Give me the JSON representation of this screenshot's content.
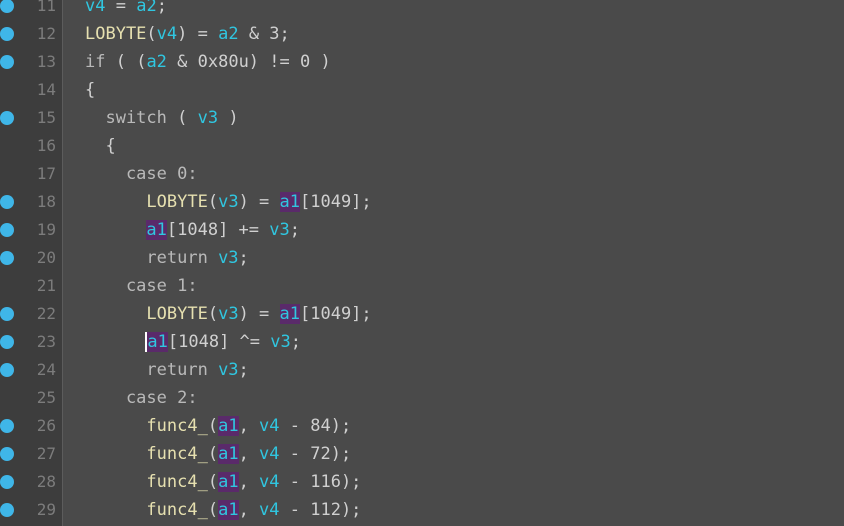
{
  "gutter": {
    "lines": [
      {
        "num": "11",
        "bp": true
      },
      {
        "num": "12",
        "bp": true
      },
      {
        "num": "13",
        "bp": true
      },
      {
        "num": "14",
        "bp": false
      },
      {
        "num": "15",
        "bp": true
      },
      {
        "num": "16",
        "bp": false
      },
      {
        "num": "17",
        "bp": false
      },
      {
        "num": "18",
        "bp": true
      },
      {
        "num": "19",
        "bp": true
      },
      {
        "num": "20",
        "bp": true
      },
      {
        "num": "21",
        "bp": false
      },
      {
        "num": "22",
        "bp": true
      },
      {
        "num": "23",
        "bp": true
      },
      {
        "num": "24",
        "bp": true
      },
      {
        "num": "25",
        "bp": false
      },
      {
        "num": "26",
        "bp": true
      },
      {
        "num": "27",
        "bp": true
      },
      {
        "num": "28",
        "bp": true
      },
      {
        "num": "29",
        "bp": true
      }
    ]
  },
  "code": {
    "lines": [
      [
        {
          "t": "v4",
          "c": "var"
        },
        {
          "t": " = ",
          "c": "op"
        },
        {
          "t": "a2",
          "c": "var"
        },
        {
          "t": ";",
          "c": "op"
        }
      ],
      [
        {
          "t": "LOBYTE",
          "c": "fn"
        },
        {
          "t": "(",
          "c": "op"
        },
        {
          "t": "v4",
          "c": "var"
        },
        {
          "t": ") = ",
          "c": "op"
        },
        {
          "t": "a2",
          "c": "var"
        },
        {
          "t": " & 3;",
          "c": "op"
        }
      ],
      [
        {
          "t": "if",
          "c": "kw"
        },
        {
          "t": " ( (",
          "c": "op"
        },
        {
          "t": "a2",
          "c": "var"
        },
        {
          "t": " & 0x80u) != 0 )",
          "c": "op"
        }
      ],
      [
        {
          "t": "{",
          "c": "op"
        }
      ],
      [
        {
          "t": "  switch",
          "c": "kw"
        },
        {
          "t": " ( ",
          "c": "op"
        },
        {
          "t": "v3",
          "c": "var"
        },
        {
          "t": " )",
          "c": "op"
        }
      ],
      [
        {
          "t": "  {",
          "c": "op"
        }
      ],
      [
        {
          "t": "    case 0:",
          "c": "kw"
        }
      ],
      [
        {
          "t": "      LOBYTE",
          "c": "fn"
        },
        {
          "t": "(",
          "c": "op"
        },
        {
          "t": "v3",
          "c": "var"
        },
        {
          "t": ") = ",
          "c": "op"
        },
        {
          "t": "a1",
          "c": "var",
          "hl": true
        },
        {
          "t": "[1049];",
          "c": "op"
        }
      ],
      [
        {
          "t": "      ",
          "c": "op"
        },
        {
          "t": "a1",
          "c": "var",
          "hl": true
        },
        {
          "t": "[1048] += ",
          "c": "op"
        },
        {
          "t": "v3",
          "c": "var"
        },
        {
          "t": ";",
          "c": "op"
        }
      ],
      [
        {
          "t": "      return ",
          "c": "kw"
        },
        {
          "t": "v3",
          "c": "var"
        },
        {
          "t": ";",
          "c": "op"
        }
      ],
      [
        {
          "t": "    case 1:",
          "c": "kw"
        }
      ],
      [
        {
          "t": "      LOBYTE",
          "c": "fn"
        },
        {
          "t": "(",
          "c": "op"
        },
        {
          "t": "v3",
          "c": "var"
        },
        {
          "t": ") = ",
          "c": "op"
        },
        {
          "t": "a1",
          "c": "var",
          "hl": true
        },
        {
          "t": "[1049];",
          "c": "op"
        }
      ],
      [
        {
          "t": "      ",
          "c": "op"
        },
        {
          "t": "a1",
          "c": "var",
          "hl": true,
          "cursor": true
        },
        {
          "t": "[1048] ^= ",
          "c": "op"
        },
        {
          "t": "v3",
          "c": "var"
        },
        {
          "t": ";",
          "c": "op"
        }
      ],
      [
        {
          "t": "      return ",
          "c": "kw"
        },
        {
          "t": "v3",
          "c": "var"
        },
        {
          "t": ";",
          "c": "op"
        }
      ],
      [
        {
          "t": "    case 2:",
          "c": "kw"
        }
      ],
      [
        {
          "t": "      func4_",
          "c": "fn"
        },
        {
          "t": "(",
          "c": "op"
        },
        {
          "t": "a1",
          "c": "var",
          "hl": true
        },
        {
          "t": ", ",
          "c": "op"
        },
        {
          "t": "v4",
          "c": "var"
        },
        {
          "t": " - 84);",
          "c": "op"
        }
      ],
      [
        {
          "t": "      func4_",
          "c": "fn"
        },
        {
          "t": "(",
          "c": "op"
        },
        {
          "t": "a1",
          "c": "var",
          "hl": true
        },
        {
          "t": ", ",
          "c": "op"
        },
        {
          "t": "v4",
          "c": "var"
        },
        {
          "t": " - 72);",
          "c": "op"
        }
      ],
      [
        {
          "t": "      func4_",
          "c": "fn"
        },
        {
          "t": "(",
          "c": "op"
        },
        {
          "t": "a1",
          "c": "var",
          "hl": true
        },
        {
          "t": ", ",
          "c": "op"
        },
        {
          "t": "v4",
          "c": "var"
        },
        {
          "t": " - 116);",
          "c": "op"
        }
      ],
      [
        {
          "t": "      func4_",
          "c": "fn"
        },
        {
          "t": "(",
          "c": "op"
        },
        {
          "t": "a1",
          "c": "var",
          "hl": true
        },
        {
          "t": ", ",
          "c": "op"
        },
        {
          "t": "v4",
          "c": "var"
        },
        {
          "t": " - 112);",
          "c": "op"
        }
      ]
    ]
  },
  "colors": {
    "background": "#4a4a4a",
    "gutter": "#3d3d3d",
    "breakpoint": "#3fb6e8",
    "variable": "#30c6e0",
    "highlight": "#5a2a6a"
  }
}
